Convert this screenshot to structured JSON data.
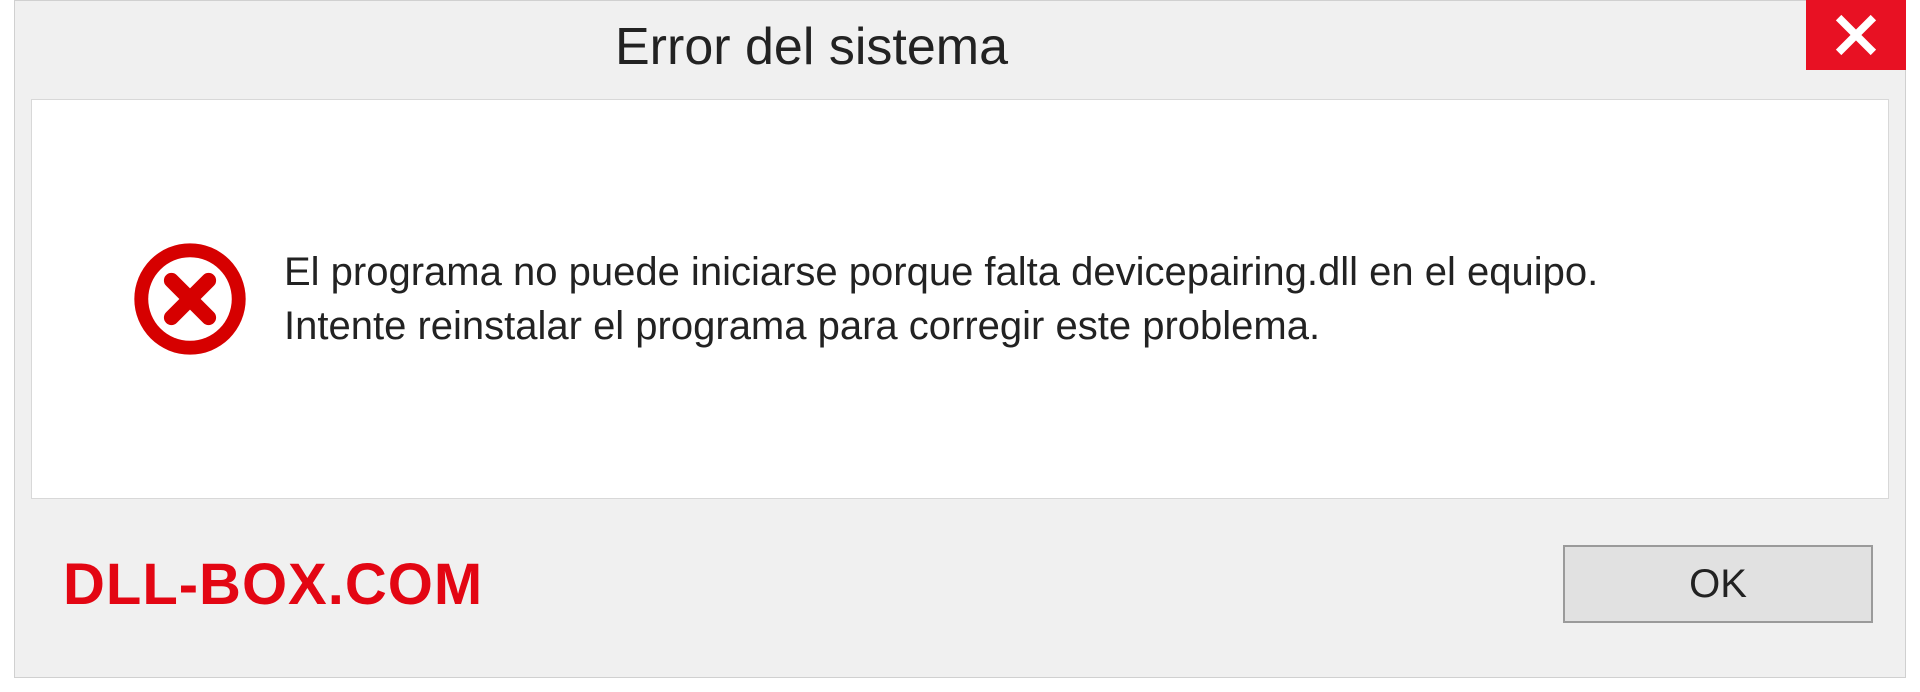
{
  "dialog": {
    "title": "Error del sistema",
    "message_line1": "El programa no puede iniciarse porque falta devicepairing.dll en el equipo.",
    "message_line2": "Intente reinstalar el programa para corregir este problema.",
    "ok_label": "OK"
  },
  "watermark": "DLL-BOX.COM"
}
